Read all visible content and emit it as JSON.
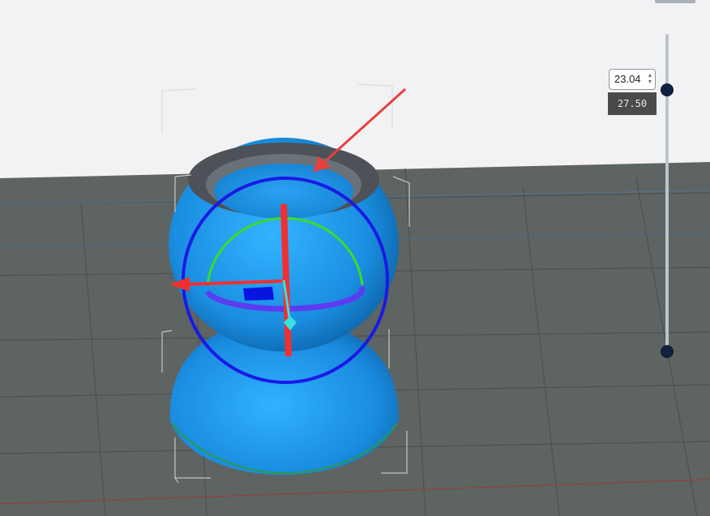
{
  "slider": {
    "current_layer_value": "23.04",
    "max_height_label": "27.50"
  },
  "icons": {
    "spin_up": "▲",
    "spin_down": "▼"
  },
  "colors": {
    "background": "#f2f2f4",
    "build_plate": "#5e6462",
    "grid_line": "#4c5150",
    "model_blue": "#1d8fe0",
    "gizmo_circle": "#1a1ae6",
    "gizmo_green_arc": "#3bdc2a",
    "gizmo_purple_ring": "#5b3cf0",
    "gizmo_red": "#f03030",
    "gizmo_cyan": "#38e0e0",
    "slider_handle": "#0f2340"
  }
}
